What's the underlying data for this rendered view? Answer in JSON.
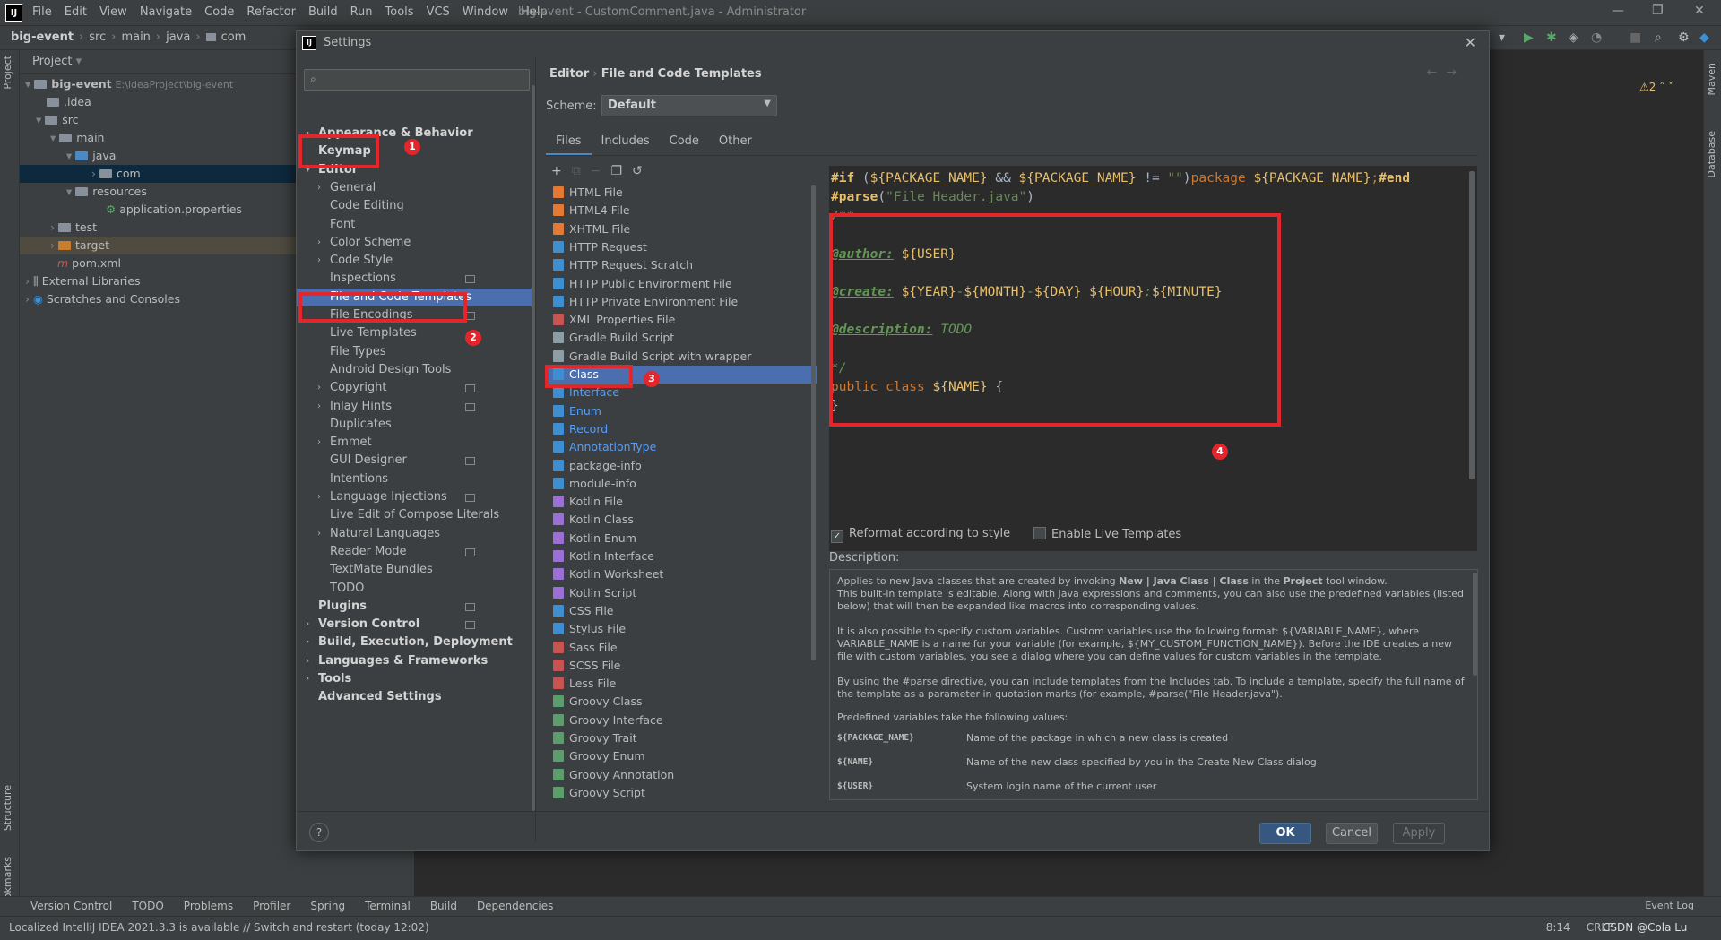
{
  "window": {
    "title": "big-event - CustomComment.java - Administrator",
    "menu": [
      "File",
      "Edit",
      "View",
      "Navigate",
      "Code",
      "Refactor",
      "Build",
      "Run",
      "Tools",
      "VCS",
      "Window",
      "Help"
    ]
  },
  "navbar": {
    "crumbs": [
      "big-event",
      "src",
      "main",
      "java",
      "com"
    ]
  },
  "project_panel": {
    "title": "Project",
    "root": "big-event",
    "root_path": "E:\\ideaProject\\big-event",
    "items": [
      ".idea",
      "src",
      "main",
      "java",
      "com",
      "resources",
      "application.properties",
      "test",
      "target",
      "pom.xml",
      "External Libraries",
      "Scratches and Consoles"
    ]
  },
  "side_labels": {
    "project": "Project",
    "structure": "Structure",
    "bookmarks": "Bookmarks",
    "maven": "Maven",
    "database": "Database"
  },
  "inspection": {
    "warnings": "2"
  },
  "dialog": {
    "title": "Settings",
    "breadcrumb": {
      "parent": "Editor",
      "current": "File and Code Templates"
    },
    "search_placeholder": "",
    "nav": [
      {
        "label": "Appearance & Behavior",
        "level": 0,
        "bold": true,
        "arrow": true
      },
      {
        "label": "Keymap",
        "level": 0,
        "bold": true,
        "arrow": false
      },
      {
        "label": "Editor",
        "level": 0,
        "bold": true,
        "arrow": true
      },
      {
        "label": "General",
        "level": 1,
        "arrow": true
      },
      {
        "label": "Code Editing",
        "level": 1
      },
      {
        "label": "Font",
        "level": 1
      },
      {
        "label": "Color Scheme",
        "level": 1,
        "arrow": true
      },
      {
        "label": "Code Style",
        "level": 1,
        "arrow": true
      },
      {
        "label": "Inspections",
        "level": 1,
        "proj": true
      },
      {
        "label": "File and Code Templates",
        "level": 1,
        "selected": true
      },
      {
        "label": "File Encodings",
        "level": 1,
        "proj": true
      },
      {
        "label": "Live Templates",
        "level": 1
      },
      {
        "label": "File Types",
        "level": 1
      },
      {
        "label": "Android Design Tools",
        "level": 1
      },
      {
        "label": "Copyright",
        "level": 1,
        "arrow": true,
        "proj": true
      },
      {
        "label": "Inlay Hints",
        "level": 1,
        "arrow": true,
        "proj": true
      },
      {
        "label": "Duplicates",
        "level": 1
      },
      {
        "label": "Emmet",
        "level": 1,
        "arrow": true
      },
      {
        "label": "GUI Designer",
        "level": 1,
        "proj": true
      },
      {
        "label": "Intentions",
        "level": 1
      },
      {
        "label": "Language Injections",
        "level": 1,
        "arrow": true,
        "proj": true
      },
      {
        "label": "Live Edit of Compose Literals",
        "level": 1
      },
      {
        "label": "Natural Languages",
        "level": 1,
        "arrow": true
      },
      {
        "label": "Reader Mode",
        "level": 1,
        "proj": true
      },
      {
        "label": "TextMate Bundles",
        "level": 1
      },
      {
        "label": "TODO",
        "level": 1
      },
      {
        "label": "Plugins",
        "level": 0,
        "bold": true,
        "proj": true
      },
      {
        "label": "Version Control",
        "level": 0,
        "bold": true,
        "arrow": true,
        "proj": true
      },
      {
        "label": "Build, Execution, Deployment",
        "level": 0,
        "bold": true,
        "arrow": true
      },
      {
        "label": "Languages & Frameworks",
        "level": 0,
        "bold": true,
        "arrow": true
      },
      {
        "label": "Tools",
        "level": 0,
        "bold": true,
        "arrow": true
      },
      {
        "label": "Advanced Settings",
        "level": 0,
        "bold": true
      }
    ],
    "scheme_label": "Scheme:",
    "scheme_value": "Default",
    "tabs": [
      "Files",
      "Includes",
      "Code",
      "Other"
    ],
    "templates": [
      {
        "name": "HTML File",
        "color": "#e37933"
      },
      {
        "name": "HTML4 File",
        "color": "#e37933"
      },
      {
        "name": "XHTML File",
        "color": "#e37933"
      },
      {
        "name": "HTTP Request",
        "color": "#3d8fd1"
      },
      {
        "name": "HTTP Request Scratch",
        "color": "#3d8fd1"
      },
      {
        "name": "HTTP Public Environment File",
        "color": "#3d8fd1"
      },
      {
        "name": "HTTP Private Environment File",
        "color": "#3d8fd1"
      },
      {
        "name": "XML Properties File",
        "color": "#c75450"
      },
      {
        "name": "Gradle Build Script",
        "color": "#8c9da6"
      },
      {
        "name": "Gradle Build Script with wrapper",
        "color": "#8c9da6"
      },
      {
        "name": "Class",
        "color": "#3d8fd1",
        "selected": true
      },
      {
        "name": "Interface",
        "color": "#3d8fd1",
        "blue": true
      },
      {
        "name": "Enum",
        "color": "#3d8fd1",
        "blue": true
      },
      {
        "name": "Record",
        "color": "#3d8fd1",
        "blue": true
      },
      {
        "name": "AnnotationType",
        "color": "#3d8fd1",
        "blue": true
      },
      {
        "name": "package-info",
        "color": "#3d8fd1"
      },
      {
        "name": "module-info",
        "color": "#3d8fd1"
      },
      {
        "name": "Kotlin File",
        "color": "#9b6fd6"
      },
      {
        "name": "Kotlin Class",
        "color": "#9b6fd6"
      },
      {
        "name": "Kotlin Enum",
        "color": "#9b6fd6"
      },
      {
        "name": "Kotlin Interface",
        "color": "#9b6fd6"
      },
      {
        "name": "Kotlin Worksheet",
        "color": "#9b6fd6"
      },
      {
        "name": "Kotlin Script",
        "color": "#9b6fd6"
      },
      {
        "name": "CSS File",
        "color": "#3d8fd1"
      },
      {
        "name": "Stylus File",
        "color": "#3d8fd1"
      },
      {
        "name": "Sass File",
        "color": "#c75450"
      },
      {
        "name": "SCSS File",
        "color": "#c75450"
      },
      {
        "name": "Less File",
        "color": "#c75450"
      },
      {
        "name": "Groovy Class",
        "color": "#5b9e6b"
      },
      {
        "name": "Groovy Interface",
        "color": "#5b9e6b"
      },
      {
        "name": "Groovy Trait",
        "color": "#5b9e6b"
      },
      {
        "name": "Groovy Enum",
        "color": "#5b9e6b"
      },
      {
        "name": "Groovy Annotation",
        "color": "#5b9e6b"
      },
      {
        "name": "Groovy Script",
        "color": "#5b9e6b"
      }
    ],
    "code": {
      "l1_if": "#if",
      "l1_a": " (",
      "l1_pkg1": "${PACKAGE_NAME}",
      "l1_and": " && ",
      "l1_pkg2": "${PACKAGE_NAME}",
      "l1_ne": " != ",
      "l1_str": "\"\"",
      "l1_close": ")",
      "l1_package": "package ",
      "l1_pkg3": "${PACKAGE_NAME}",
      "l1_semi": ";",
      "l1_end": "#end",
      "l2_parse": "#parse",
      "l2_open": "(",
      "l2_str": "\"File Header.java\"",
      "l2_close": ")",
      "l3": "/**",
      "l5_tag": "@author:",
      "l5_val": "${USER}",
      "l7_tag": "@create:",
      "l7_year": "${YEAR}",
      "l7_month": "${MONTH}",
      "l7_day": "${DAY}",
      "l7_hour": "${HOUR}",
      "l7_minute": "${MINUTE}",
      "dash": "-",
      "colon": ":",
      "space": " ",
      "l9_tag": "@description:",
      "l9_val": "TODO",
      "l11": "*/",
      "l12_public": "public class ",
      "l12_name": "${NAME}",
      "l12_brace": " {",
      "l13": "}"
    },
    "reformat_label": "Reformat according to style",
    "reformat_checked": true,
    "live_templates_label": "Enable Live Templates",
    "live_templates_checked": false,
    "description_label": "Description:",
    "description": {
      "p1a": "Applies to new Java classes that are created by invoking ",
      "p1b": "New | Java Class | Class",
      "p1c": " in the ",
      "p1d": "Project",
      "p1e": " tool window.",
      "p2": "This built-in template is editable. Along with Java expressions and comments, you can also use the predefined variables (listed below) that will then be expanded like macros into corresponding values.",
      "p3": "It is also possible to specify custom variables. Custom variables use the following format: ${VARIABLE_NAME}, where VARIABLE_NAME is a name for your variable (for example, ${MY_CUSTOM_FUNCTION_NAME}). Before the IDE creates a new file with custom variables, you see a dialog where you can define values for custom variables in the template.",
      "p4": "By using the #parse directive, you can include templates from the Includes tab. To include a template, specify the full name of the template as a parameter in quotation marks (for example, #parse(\"File Header.java\").",
      "p5": "Predefined variables take the following values:",
      "vars": [
        {
          "name": "${PACKAGE_NAME}",
          "desc": "Name of the package in which a new class is created"
        },
        {
          "name": "${NAME}",
          "desc": "Name of the new class specified by you in the Create New Class dialog"
        },
        {
          "name": "${USER}",
          "desc": "System login name of the current user"
        }
      ]
    },
    "buttons": {
      "help": "?",
      "ok": "OK",
      "cancel": "Cancel",
      "apply": "Apply"
    }
  },
  "annotations": [
    "1",
    "2",
    "3",
    "4"
  ],
  "toolwindows": [
    "Version Control",
    "TODO",
    "Problems",
    "Profiler",
    "Spring",
    "Terminal",
    "Build",
    "Dependencies"
  ],
  "event_log": "Event Log",
  "status": {
    "message": "Localized IntelliJ IDEA 2021.3.3 is available // Switch and restart (today 12:02)",
    "position": "8:14",
    "line_sep": "CRLF",
    "watermark": "CSDN @Cola Lu"
  },
  "colors": {
    "accent": "#4b6eaf",
    "annotation": "#e3262b",
    "ok_button": "#365880"
  }
}
